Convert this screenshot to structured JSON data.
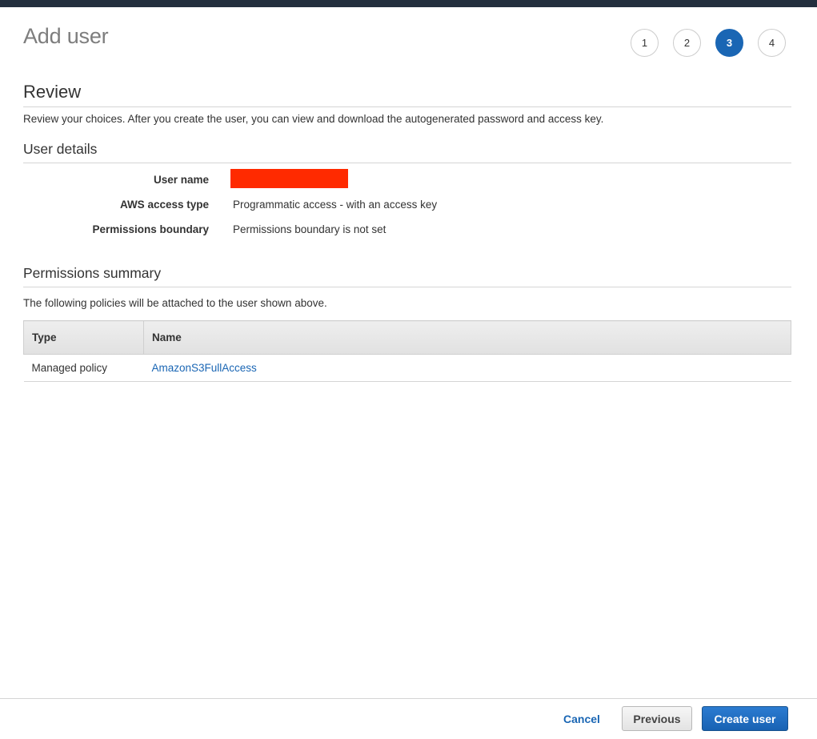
{
  "header": {
    "title": "Add user",
    "steps": [
      "1",
      "2",
      "3",
      "4"
    ],
    "active_step": "3"
  },
  "review": {
    "title": "Review",
    "description": "Review your choices. After you create the user, you can view and download the autogenerated password and access key."
  },
  "user_details": {
    "title": "User details",
    "rows": [
      {
        "label": "User name",
        "value": ""
      },
      {
        "label": "AWS access type",
        "value": "Programmatic access - with an access key"
      },
      {
        "label": "Permissions boundary",
        "value": "Permissions boundary is not set"
      }
    ],
    "redaction_color": "#ff2a00"
  },
  "permissions": {
    "title": "Permissions summary",
    "description": "The following policies will be attached to the user shown above.",
    "columns": [
      "Type",
      "Name"
    ],
    "rows": [
      {
        "type": "Managed policy",
        "name": "AmazonS3FullAccess"
      }
    ]
  },
  "footer": {
    "cancel_label": "Cancel",
    "previous_label": "Previous",
    "create_label": "Create user"
  },
  "colors": {
    "accent": "#1a66b4",
    "top_bar": "#232f3e"
  }
}
